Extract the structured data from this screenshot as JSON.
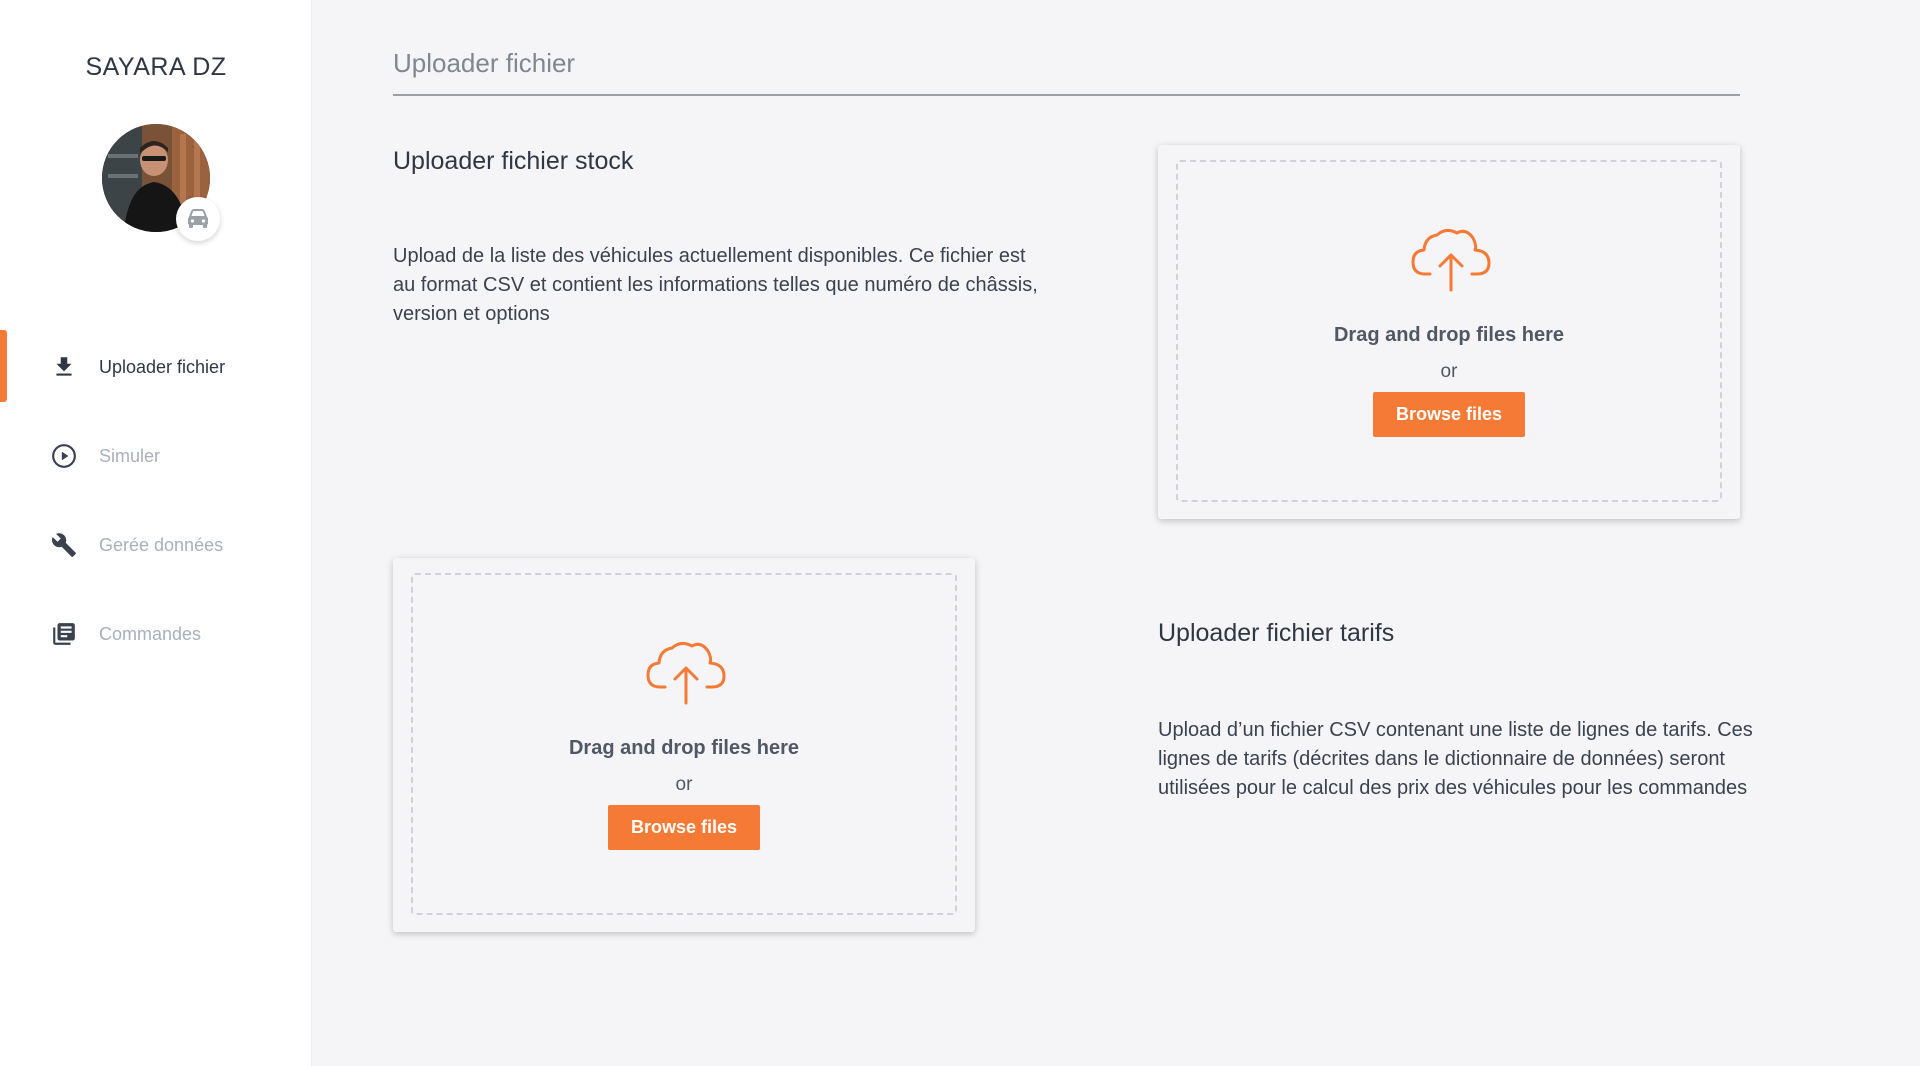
{
  "app": {
    "brand": "SAYARA DZ"
  },
  "colors": {
    "accent": "#f47a35",
    "active_text": "#2f3744",
    "inactive_text": "#a9b0ba"
  },
  "sidebar": {
    "items": [
      {
        "label": "Uploader fichier",
        "icon": "download-icon",
        "active": true
      },
      {
        "label": "Simuler",
        "icon": "play-circle-icon",
        "active": false
      },
      {
        "label": "Gerée données",
        "icon": "wrench-icon",
        "active": false
      },
      {
        "label": "Commandes",
        "icon": "library-books-icon",
        "active": false
      }
    ],
    "avatar_badge_icon": "car-icon"
  },
  "main": {
    "title": "Uploader fichier",
    "stock": {
      "title": "Uploader fichier stock",
      "description": "Upload de la liste des véhicules actuellement disponibles. Ce fichier est au format CSV et contient les informations telles que numéro de châssis, version et options"
    },
    "tarifs": {
      "title": "Uploader fichier tarifs",
      "description": "Upload d’un fichier CSV contenant une liste de lignes de tarifs. Ces lignes de tarifs (décrites dans le dictionnaire de données) seront utilisées pour le calcul des prix des véhicules pour les commandes"
    },
    "uploader": {
      "icon": "cloud-upload-icon",
      "drag_text": "Drag and drop files here",
      "or_text": "or",
      "browse_label": "Browse files"
    }
  }
}
